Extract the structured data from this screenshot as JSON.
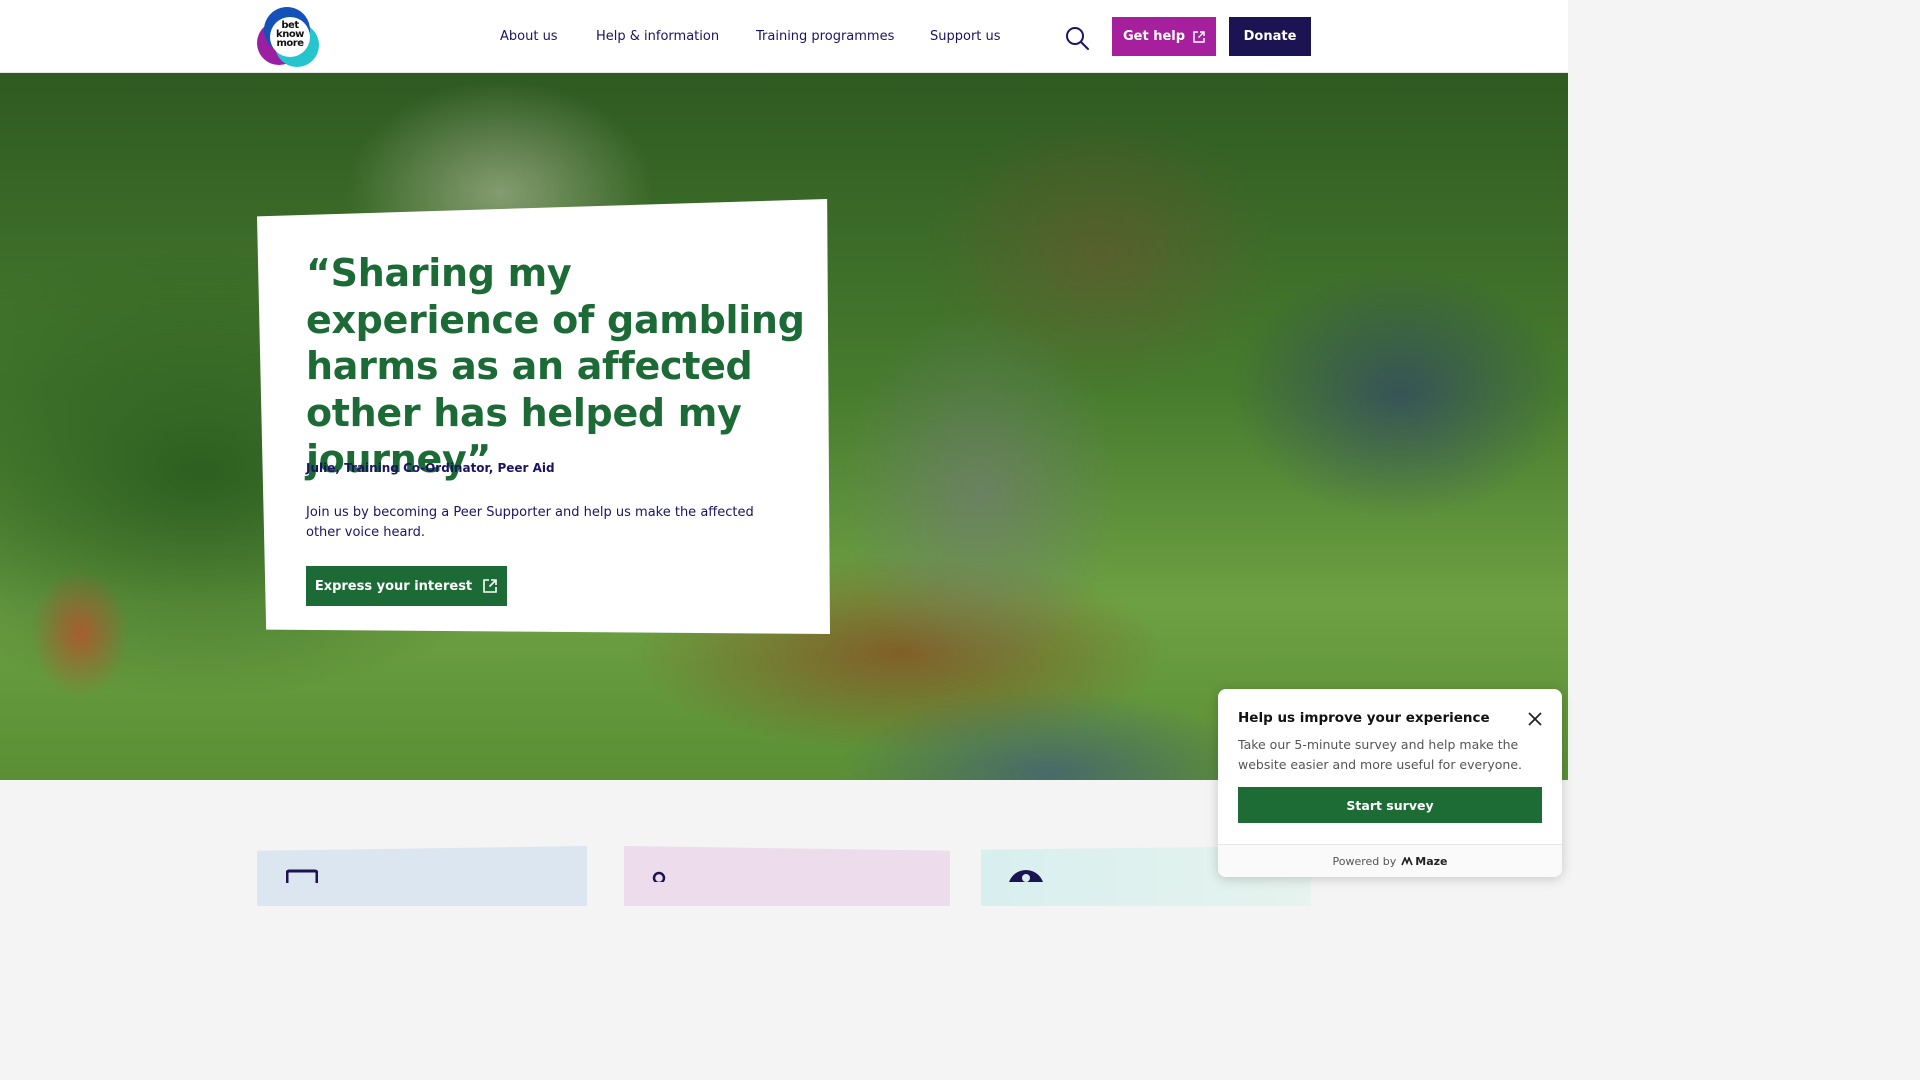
{
  "logo": {
    "text_lines": [
      "bet",
      "know",
      "more"
    ]
  },
  "nav": {
    "items": [
      "About us",
      "Help & information",
      "Training programmes",
      "Support us"
    ]
  },
  "header": {
    "search_icon": "search-icon",
    "get_help_label": "Get help",
    "donate_label": "Donate"
  },
  "hero": {
    "quote": "“Sharing my experience of gambling harms as an affected other has helped my journey”",
    "attribution": "Julie, Training Co-Ordinator, Peer Aid",
    "blurb": "Join us by becoming a Peer Supporter and help us make the affected other voice heard.",
    "cta_label": "Express your interest"
  },
  "survey": {
    "title": "Help us improve your experience",
    "text": "Take our 5-minute survey and help make the website easier and more useful for everyone.",
    "button_label": "Start survey",
    "footer_prefix": "Powered by",
    "footer_brand": "Maze"
  },
  "colors": {
    "primary_green": "#1c6a35",
    "get_help_purple": "#a6209e",
    "donate_navy": "#1b1352",
    "text_navy": "#1b1464"
  }
}
